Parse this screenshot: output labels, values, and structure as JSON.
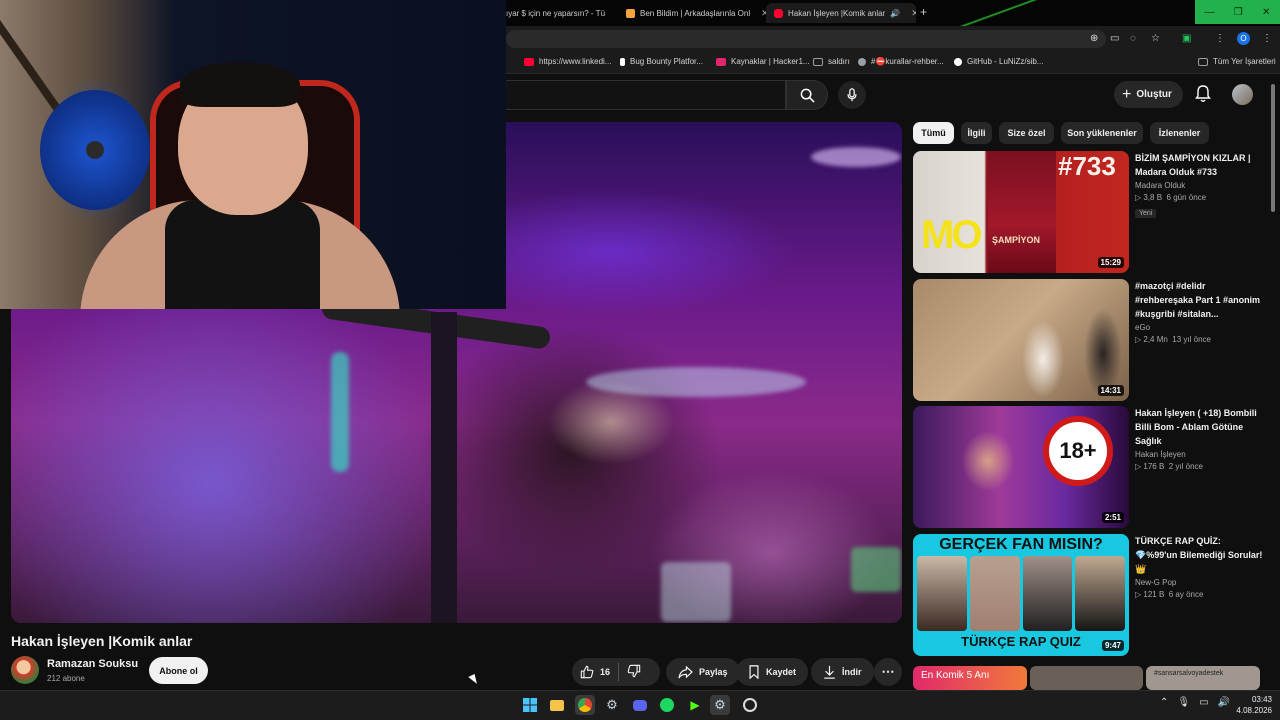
{
  "browser": {
    "tabs": [
      {
        "title": "ıyar $ için ne yaparsın? - Tü",
        "favicon_color": "#ffffff"
      },
      {
        "title": "Ben Bildim | Arkadaşlarınla Onl",
        "favicon_color": "#f4a340"
      },
      {
        "title": "Hakan İşleyen |Komik anlar",
        "favicon_color": "#ff0033"
      }
    ],
    "new_tab_symbol": "+",
    "bookmarks": [
      {
        "label": "https://www.linkedi...",
        "color": "#ff0033"
      },
      {
        "label": "Bug Bounty Platfor...",
        "color": "#ffffff"
      },
      {
        "label": "Kaynaklar | Hacker1...",
        "color": "#e2246f"
      },
      {
        "label": "saldırı",
        "color": "#9aa0a6"
      },
      {
        "label": "#⛔kurallar-rehber...",
        "color": "#9aa0a6"
      },
      {
        "label": "GitHub - LuNiZz/sib...",
        "color": "#ffffff"
      }
    ],
    "all_bookmarks": "Tüm Yer İşaretleri",
    "profile_initial": "O"
  },
  "youtube": {
    "search_placeholder": "",
    "create_label": "Oluştur",
    "video": {
      "title": "Hakan İşleyen |Komik anlar",
      "channel": "Ramazan Souksu",
      "subscribers": "212 abone",
      "subscribe_label": "Abone ol",
      "likes": "16",
      "share_label": "Paylaş",
      "save_label": "Kaydet",
      "download_label": "İndir"
    },
    "chips": [
      "Tümü",
      "İlgili",
      "Size özel",
      "Son yüklenenler",
      "İzlenenler"
    ],
    "recommendations": [
      {
        "title": "BİZİM ŞAMPİYON KIZLAR | Madara Olduk #733",
        "channel": "Madara Olduk",
        "views": "3,8 B",
        "age": "6 gün önce",
        "badge": "Yeni",
        "duration": "15:29"
      },
      {
        "title": "#mazotçi #delidr #rehbereşaka Part 1 #anonim #kuşgribi #sitalan...",
        "channel": "eGo",
        "views": "2,4 Mn",
        "age": "13 yıl önce",
        "badge": "",
        "duration": "14:31"
      },
      {
        "title": "Hakan İşleyen ( +18) Bombili Billi Bom - Ablam Götüne Sağlık",
        "channel": "Hakan İşleyen",
        "views": "176 B",
        "age": "2 yıl önce",
        "badge": "",
        "duration": "2:51"
      },
      {
        "title": "TÜRKÇE RAP QUİZ: 💎%99'un Bilemediği Sorular! 👑",
        "channel": "New-G Pop",
        "views": "121 B",
        "age": "6 ay önce",
        "badge": "",
        "duration": "9:47"
      }
    ],
    "thumb_text": {
      "madara_number": "#733",
      "madara_logo": "MO",
      "madara_poster": "ŞAMPİYON",
      "eighteen": "18+",
      "rap_top": "GERÇEK FAN MISIN?",
      "rap_bottom": "TÜRKÇE RAP QUIZ"
    },
    "shelf": [
      "En Komik 5 Anı",
      "",
      "#sansarsalvoyadestek"
    ]
  },
  "taskbar": {
    "time": "03:43",
    "date": "4.08.2026"
  }
}
